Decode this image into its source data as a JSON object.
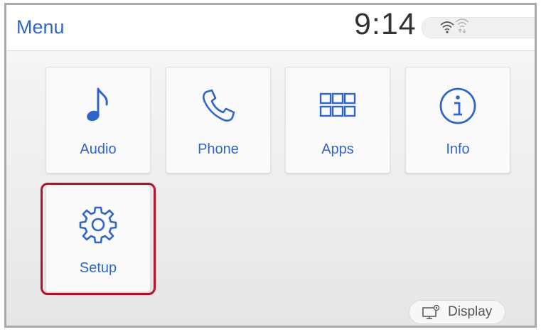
{
  "header": {
    "title": "Menu",
    "clock": "9:14"
  },
  "menu": {
    "items": [
      {
        "label": "Audio",
        "icon": "music-note-icon"
      },
      {
        "label": "Phone",
        "icon": "phone-icon"
      },
      {
        "label": "Apps",
        "icon": "apps-grid-icon"
      },
      {
        "label": "Info",
        "icon": "info-icon"
      },
      {
        "label": "Setup",
        "icon": "gear-icon",
        "highlighted": true
      }
    ]
  },
  "footer": {
    "display_label": "Display",
    "display_icon": "display-settings-icon"
  },
  "colors": {
    "accent": "#2f66c8",
    "highlight_border": "#b0112f"
  }
}
